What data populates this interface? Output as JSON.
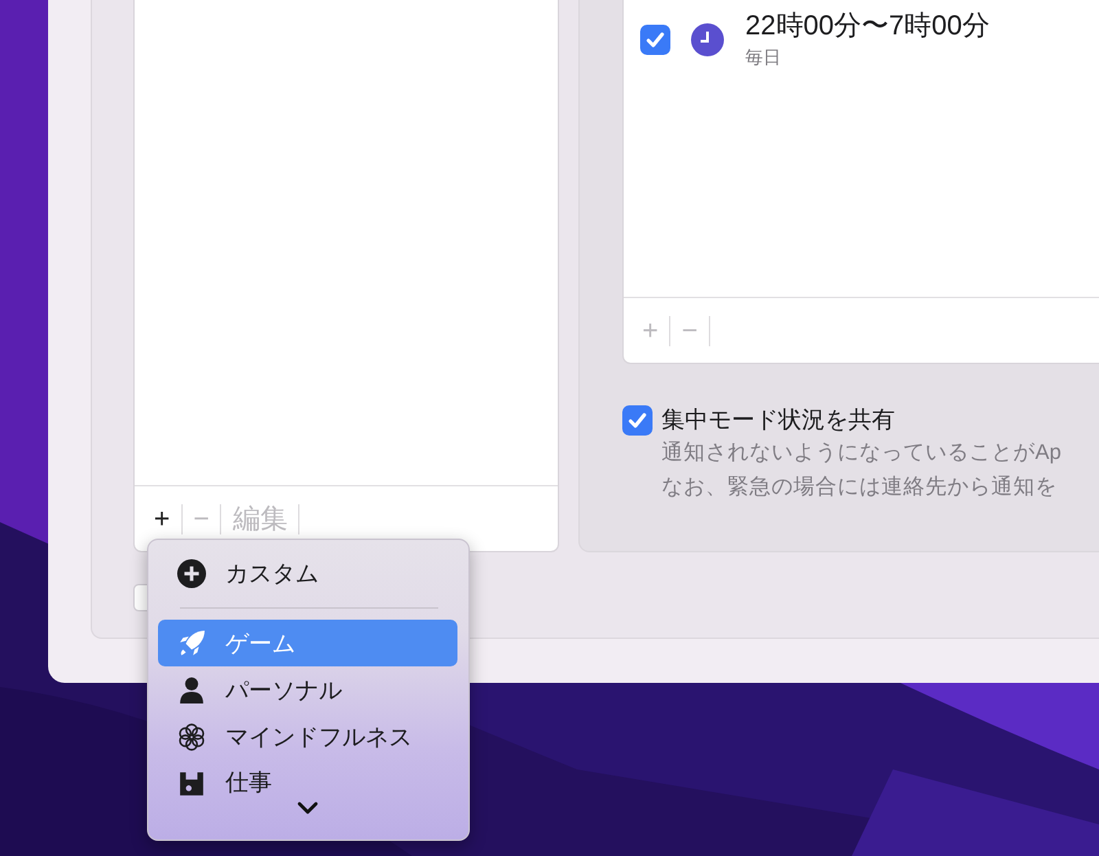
{
  "focus_list": {
    "toolbar": [
      {
        "label": "+",
        "disabled": false
      },
      {
        "label": "−",
        "disabled": true
      },
      {
        "label": "編集",
        "disabled": true
      }
    ]
  },
  "bottom_checkbox": {
    "checked": false
  },
  "schedule": {
    "items": [
      {
        "checked": true,
        "title": "22時00分〜7時00分",
        "subtitle": "毎日"
      }
    ],
    "toolbar": [
      {
        "label": "+",
        "disabled": true
      },
      {
        "label": "−",
        "disabled": true
      }
    ]
  },
  "share_status": {
    "checked": true,
    "label": "集中モード状況を共有",
    "description": [
      "通知されないようになっていることがAp",
      "なお、緊急の場合には連絡先から通知を"
    ]
  },
  "menu": {
    "items": [
      {
        "kind": "add",
        "label": "カスタム",
        "selected": false
      },
      {
        "kind": "separator"
      },
      {
        "kind": "rocket",
        "label": "ゲーム",
        "selected": true
      },
      {
        "kind": "person",
        "label": "パーソナル",
        "selected": false
      },
      {
        "kind": "flower",
        "label": "マインドフルネス",
        "selected": false
      },
      {
        "kind": "work",
        "label": "仕事",
        "selected": false
      }
    ]
  }
}
